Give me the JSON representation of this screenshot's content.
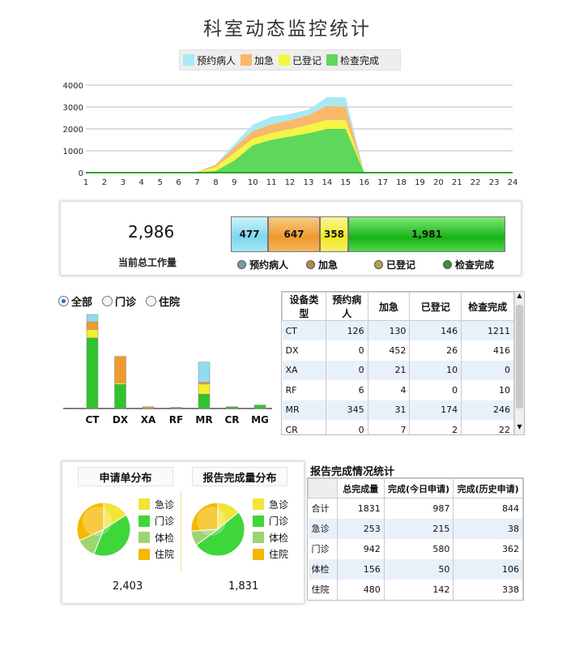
{
  "title": "科室动态监控统计",
  "legend": [
    {
      "label": "预约病人",
      "color": "#a8e9f5"
    },
    {
      "label": "加急",
      "color": "#f9b86a"
    },
    {
      "label": "已登记",
      "color": "#f5f542"
    },
    {
      "label": "检查完成",
      "color": "#5ed85b"
    }
  ],
  "chart_data": [
    {
      "type": "area",
      "x": [
        1,
        2,
        3,
        4,
        5,
        6,
        7,
        8,
        9,
        10,
        11,
        12,
        13,
        14,
        15,
        16,
        17,
        18,
        19,
        20,
        21,
        22,
        23,
        24
      ],
      "ylim": [
        0,
        4000
      ],
      "yticks": [
        0,
        1000,
        2000,
        3000,
        4000
      ],
      "series": [
        {
          "name": "检查完成",
          "values": [
            0,
            0,
            0,
            0,
            0,
            0,
            10,
            80,
            550,
            1250,
            1500,
            1650,
            1800,
            2000,
            2000,
            0,
            0,
            0,
            0,
            0,
            0,
            0,
            0,
            0
          ]
        },
        {
          "name": "已登记",
          "values": [
            0,
            0,
            0,
            0,
            0,
            0,
            20,
            180,
            350,
            300,
            300,
            330,
            380,
            400,
            400,
            0,
            0,
            0,
            0,
            0,
            0,
            0,
            0,
            0
          ]
        },
        {
          "name": "加急",
          "values": [
            0,
            0,
            0,
            0,
            0,
            0,
            10,
            100,
            250,
            350,
            400,
            400,
            450,
            650,
            620,
            0,
            0,
            0,
            0,
            0,
            0,
            0,
            0,
            0
          ]
        },
        {
          "name": "预约病人",
          "values": [
            0,
            0,
            0,
            0,
            0,
            0,
            0,
            20,
            150,
            300,
            350,
            300,
            250,
            400,
            420,
            0,
            0,
            0,
            0,
            0,
            0,
            0,
            0,
            0
          ]
        }
      ]
    },
    {
      "type": "bar",
      "categories": [
        "CT",
        "DX",
        "XA",
        "RF",
        "MR",
        "CR",
        "MG"
      ],
      "series": [
        {
          "name": "检查完成",
          "values": [
            1211,
            416,
            0,
            10,
            246,
            22,
            60
          ]
        },
        {
          "name": "已登记",
          "values": [
            146,
            26,
            10,
            0,
            174,
            2,
            0
          ]
        },
        {
          "name": "加急",
          "values": [
            130,
            452,
            21,
            4,
            31,
            7,
            0
          ]
        },
        {
          "name": "预约病人",
          "values": [
            126,
            0,
            0,
            6,
            345,
            0,
            0
          ]
        }
      ]
    },
    {
      "type": "pie",
      "title": "申请单分布",
      "categories": [
        "急诊",
        "门诊",
        "体检",
        "住院"
      ],
      "values": [
        0.16,
        0.4,
        0.12,
        0.32
      ]
    },
    {
      "type": "pie",
      "title": "报告完成量分布",
      "categories": [
        "急诊",
        "门诊",
        "体检",
        "住院"
      ],
      "values": [
        0.14,
        0.51,
        0.09,
        0.26
      ]
    }
  ],
  "summary": {
    "total": "2,986",
    "total_label": "当前总工作量",
    "segments": [
      {
        "label": "预约病人",
        "value": 477,
        "color": "#8fdcf0",
        "dot": "#7a9aa8"
      },
      {
        "label": "加急",
        "value": 647,
        "color": "#f5a53a",
        "dot": "#b08848"
      },
      {
        "label": "已登记",
        "value": 358,
        "color": "#f5ee2a",
        "dot": "#b0a640"
      },
      {
        "label": "检查完成",
        "value": 1981,
        "color": "#2fc42c",
        "dot": "#3f8f3f"
      }
    ],
    "values_text": [
      "477",
      "647",
      "358",
      "1,981"
    ]
  },
  "filters": [
    {
      "label": "全部",
      "selected": true
    },
    {
      "label": "门诊",
      "selected": false
    },
    {
      "label": "住院",
      "selected": false
    }
  ],
  "device_table": {
    "headers": [
      "设备类型",
      "预约病人",
      "加急",
      "已登记",
      "检查完成"
    ],
    "rows": [
      [
        "CT",
        "126",
        "130",
        "146",
        "1211"
      ],
      [
        "DX",
        "0",
        "452",
        "26",
        "416"
      ],
      [
        "XA",
        "0",
        "21",
        "10",
        "0"
      ],
      [
        "RF",
        "6",
        "4",
        "0",
        "10"
      ],
      [
        "MR",
        "345",
        "31",
        "174",
        "246"
      ],
      [
        "CR",
        "0",
        "7",
        "2",
        "22"
      ]
    ]
  },
  "pies": [
    {
      "title": "申请单分布",
      "total": "2,403"
    },
    {
      "title": "报告完成量分布",
      "total": "1,831"
    }
  ],
  "pie_legend": [
    {
      "label": "急诊",
      "color": "#f2e43a"
    },
    {
      "label": "门诊",
      "color": "#3fd63a"
    },
    {
      "label": "体检",
      "color": "#9fd470"
    },
    {
      "label": "住院",
      "color": "#f5b800"
    }
  ],
  "report_table": {
    "title": "报告完成情况统计",
    "headers": [
      "",
      "总完成量",
      "完成(今日申请)",
      "完成(历史申请)"
    ],
    "rows": [
      [
        "合计",
        "1831",
        "987",
        "844"
      ],
      [
        "急诊",
        "253",
        "215",
        "38"
      ],
      [
        "门诊",
        "942",
        "580",
        "362"
      ],
      [
        "体检",
        "156",
        "50",
        "106"
      ],
      [
        "住院",
        "480",
        "142",
        "338"
      ]
    ]
  }
}
